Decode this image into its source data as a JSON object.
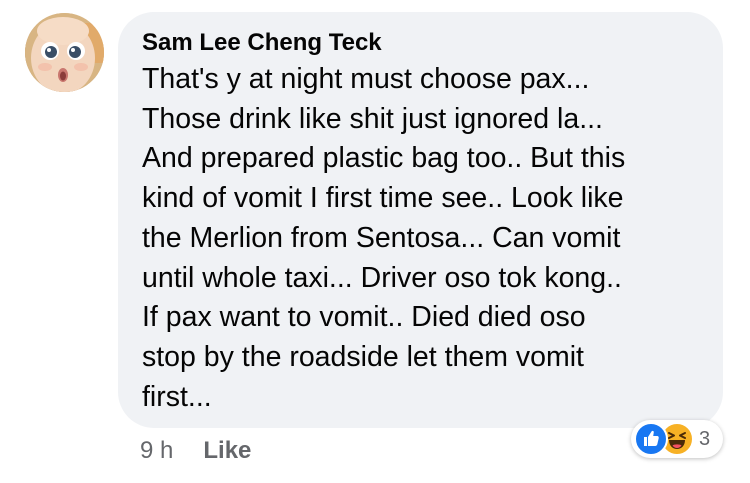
{
  "comment": {
    "author": "Sam Lee Cheng Teck",
    "avatar_icon": "baby-face-avatar",
    "lines": [
      "That's y at night must choose pax...",
      "Those drink like shit just ignored la...",
      "And prepared plastic bag too.. But this",
      "kind of vomit I first time see.. Look like",
      "the Merlion from Sentosa... Can vomit",
      "until whole taxi... Driver oso tok kong..",
      "If pax want to vomit.. Died died oso",
      "stop by the roadside let them vomit",
      "first..."
    ]
  },
  "actions": {
    "time": "9 h",
    "like_label": "Like"
  },
  "reactions": {
    "icons": [
      "like-icon",
      "haha-icon"
    ],
    "count": "3"
  },
  "colors": {
    "bubble_bg": "#f0f2f5",
    "text": "#050505",
    "meta_text": "#65676b",
    "like_blue": "#1877f2",
    "haha_yellow": "#f7b125"
  }
}
